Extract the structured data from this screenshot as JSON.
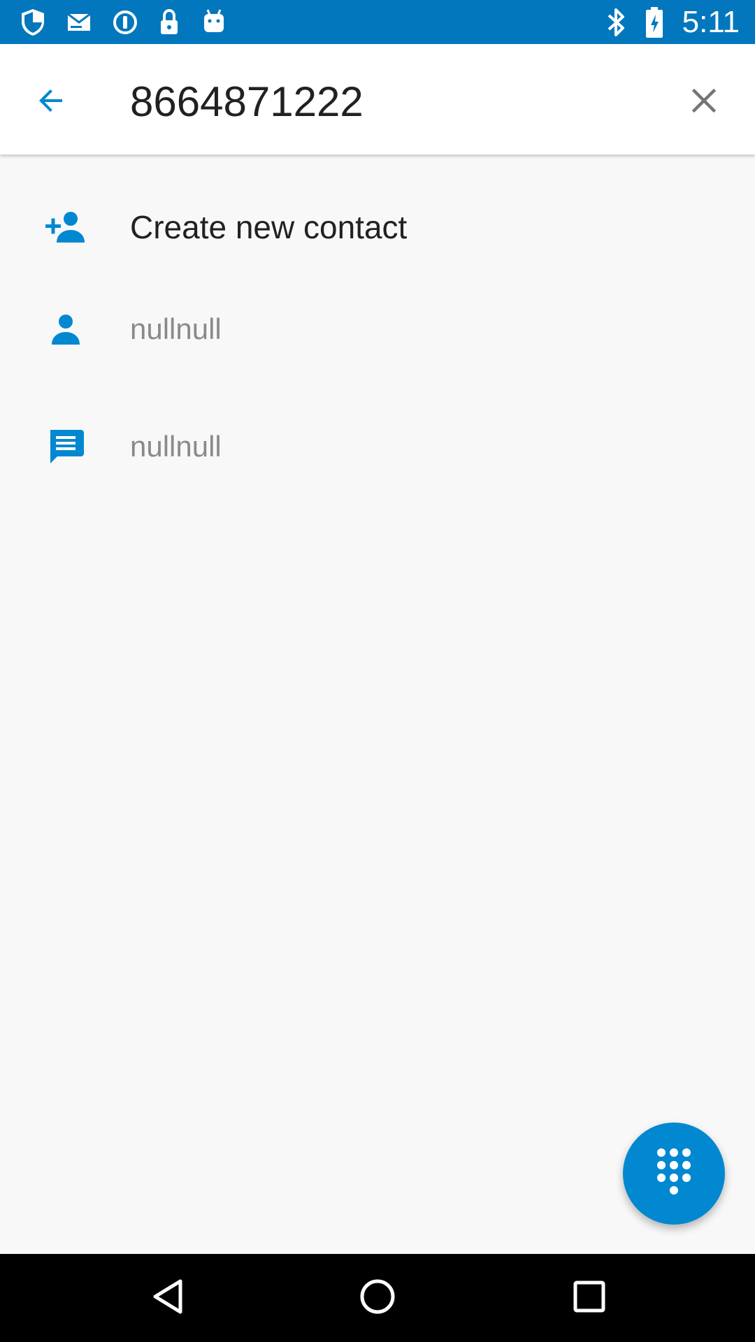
{
  "status_bar": {
    "time": "5:11",
    "background_color": "#0277bd",
    "left_icons": [
      "shield-icon",
      "mail-icon",
      "info-circle-icon",
      "lock-icon",
      "android-icon"
    ],
    "right_icons": [
      "bluetooth-icon",
      "battery-icon"
    ]
  },
  "search": {
    "query": "8664871222",
    "back_icon": "arrow-left-icon",
    "clear_icon": "close-icon"
  },
  "results": [
    {
      "icon": "person-add-icon",
      "label": "Create new contact"
    },
    {
      "icon": "person-icon",
      "label": "nullnull"
    },
    {
      "icon": "message-icon",
      "label": "nullnull"
    }
  ],
  "fab": {
    "icon": "dialpad-icon",
    "color": "#0288d1"
  },
  "navigation": {
    "buttons": [
      "back-triangle-icon",
      "home-circle-icon",
      "recents-square-icon"
    ]
  },
  "colors": {
    "accent": "#0288d1",
    "background": "#f8f8f8",
    "primary_text": "#212121",
    "secondary_text": "#8a8a8a"
  }
}
